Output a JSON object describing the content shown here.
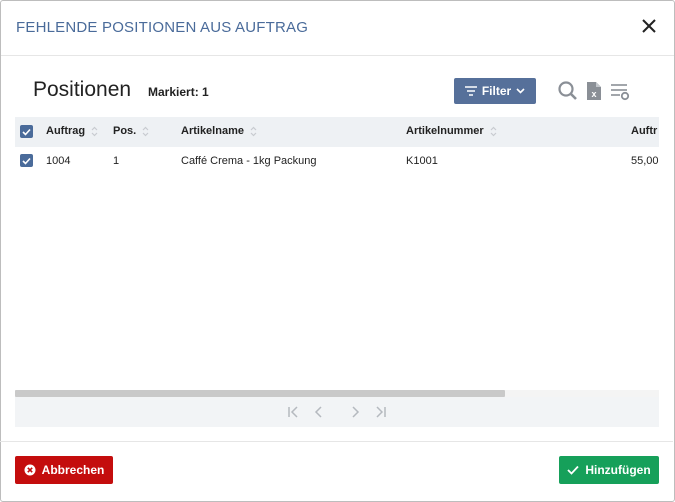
{
  "dialog": {
    "title": "FEHLENDE POSITIONEN AUS AUFTRAG",
    "close_icon": "close-icon"
  },
  "section": {
    "title": "Positionen",
    "marked": "Markiert: 1"
  },
  "toolbar": {
    "filter_label": "Filter",
    "icons": [
      "search-icon",
      "excel-export-icon",
      "column-settings-icon"
    ]
  },
  "table": {
    "columns": [
      "Auftrag",
      "Pos.",
      "Artikelname",
      "Artikelnummer",
      "Auftr"
    ],
    "rows": [
      {
        "checked": true,
        "cells": [
          "1004",
          "1",
          "Caffé Crema - 1kg Packung",
          "K1001",
          "55,00"
        ]
      }
    ]
  },
  "pagination": {
    "icons": [
      "first-page-icon",
      "prev-page-icon",
      "next-page-icon",
      "last-page-icon"
    ]
  },
  "footer": {
    "cancel_label": "Abbrechen",
    "add_label": "Hinzufügen"
  },
  "colors": {
    "title": "#4a6b9a",
    "filter": "#56709a",
    "cancel": "#c40d0d",
    "add": "#16a05a"
  }
}
